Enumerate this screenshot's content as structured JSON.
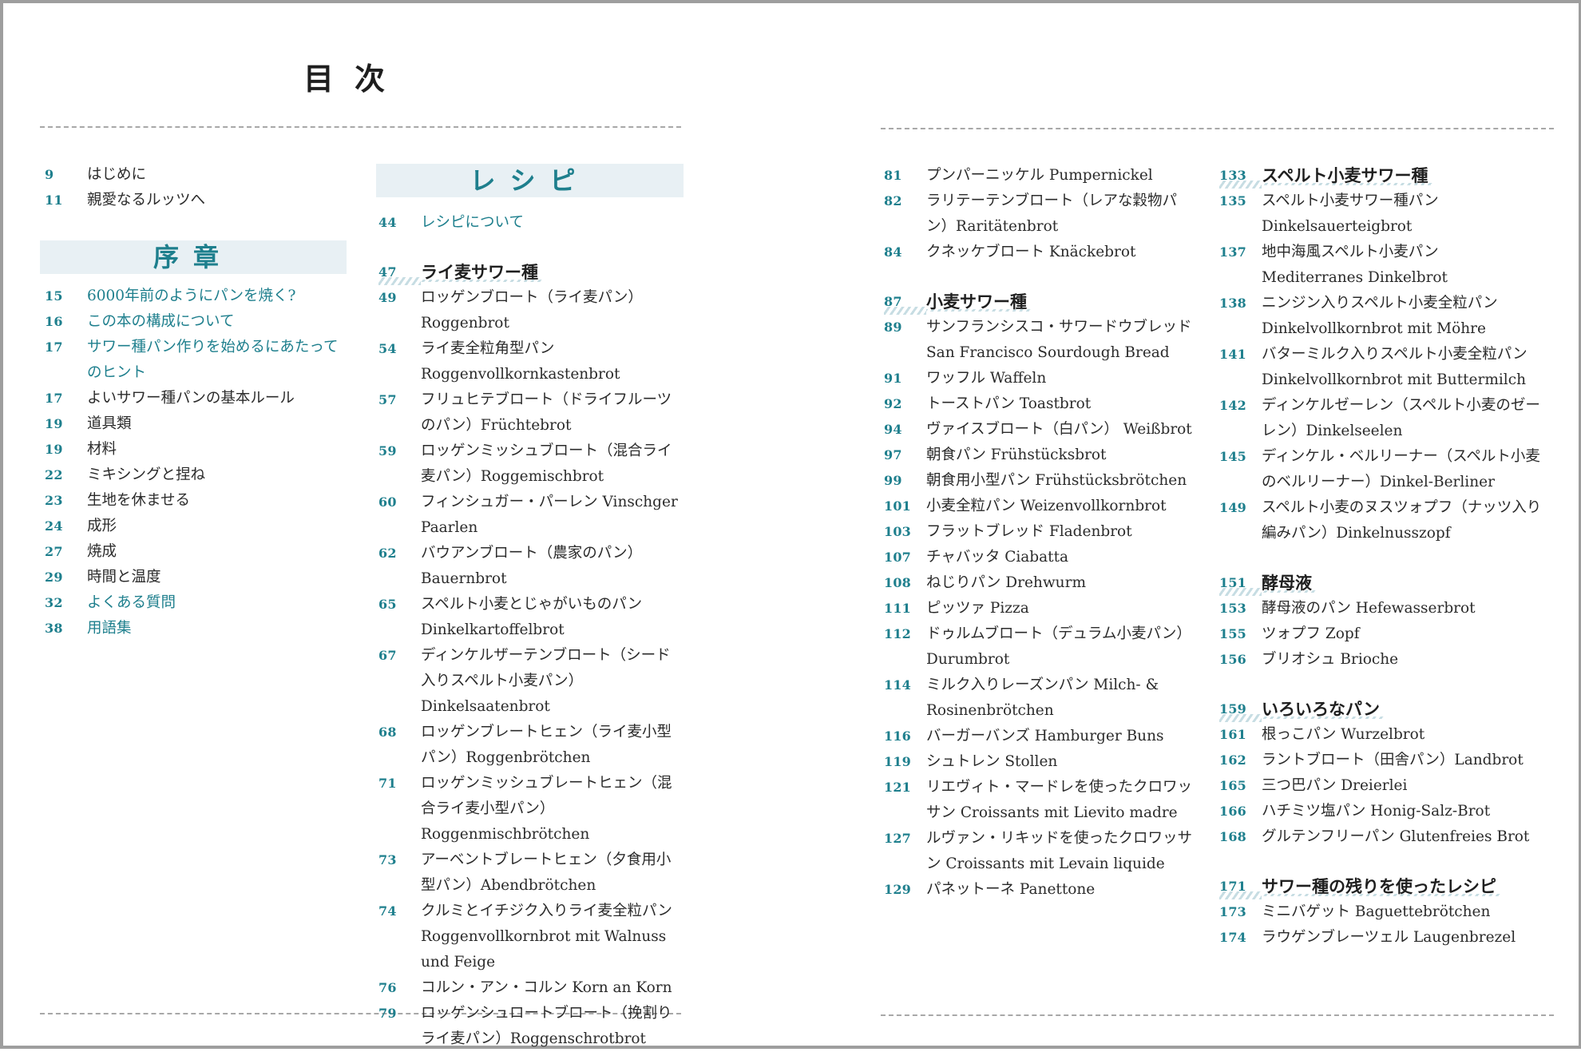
{
  "title": "目次",
  "colors": {
    "accent": "#1e7f8d",
    "banner_bg": "#e8f0f4",
    "text": "#2b2b2b"
  },
  "col1": {
    "intro": [
      {
        "page": "9",
        "text": "はじめに"
      },
      {
        "page": "11",
        "text": "親愛なるルッツへ"
      }
    ],
    "banner": "序章",
    "items": [
      {
        "page": "15",
        "text": "6000年前のようにパンを焼く?",
        "highlight": true
      },
      {
        "page": "16",
        "text": "この本の構成について",
        "highlight": true
      },
      {
        "page": "17",
        "text": "サワー種パン作りを始めるにあたってのヒント",
        "highlight": true
      },
      {
        "page": "17",
        "text": "よいサワー種パンの基本ルール"
      },
      {
        "page": "19",
        "text": "道具類"
      },
      {
        "page": "19",
        "text": "材料"
      },
      {
        "page": "22",
        "text": "ミキシングと捏ね"
      },
      {
        "page": "23",
        "text": "生地を休ませる"
      },
      {
        "page": "24",
        "text": "成形"
      },
      {
        "page": "27",
        "text": "焼成"
      },
      {
        "page": "29",
        "text": "時間と温度"
      },
      {
        "page": "32",
        "text": "よくある質問",
        "highlight": true
      },
      {
        "page": "38",
        "text": "用語集",
        "highlight": true
      }
    ]
  },
  "col2": {
    "banner": "レシピ",
    "items": [
      {
        "page": "44",
        "text": "レシピについて",
        "highlight": true
      },
      {
        "page": "47",
        "text": "ライ麦サワー種",
        "section": true
      },
      {
        "page": "49",
        "text": "ロッゲンブロート（ライ麦パン）Roggenbrot"
      },
      {
        "page": "54",
        "text": "ライ麦全粒角型パン Roggenvollkornkastenbrot"
      },
      {
        "page": "57",
        "text": "フリュヒテブロート（ドライフルーツのパン）Früchtebrot"
      },
      {
        "page": "59",
        "text": "ロッゲンミッシュブロート（混合ライ麦パン）Roggemischbrot"
      },
      {
        "page": "60",
        "text": "フィンシュガー・パーレン Vinschger Paarlen"
      },
      {
        "page": "62",
        "text": "バウアンブロート（農家のパン）Bauernbrot"
      },
      {
        "page": "65",
        "text": "スペルト小麦とじゃがいものパン Dinkelkartoffelbrot"
      },
      {
        "page": "67",
        "text": "ディンケルザーテンブロート（シード入りスペルト小麦パン）Dinkelsaatenbrot"
      },
      {
        "page": "68",
        "text": "ロッゲンブレートヒェン（ライ麦小型パン）Roggenbrötchen"
      },
      {
        "page": "71",
        "text": "ロッゲンミッシュブレートヒェン（混合ライ麦小型パン）Roggenmischbrötchen"
      },
      {
        "page": "73",
        "text": "アーベントブレートヒェン（夕食用小型パン）Abendbrötchen"
      },
      {
        "page": "74",
        "text": "クルミとイチジク入りライ麦全粒パン Roggenvollkornbrot mit Walnuss und Feige"
      },
      {
        "page": "76",
        "text": "コルン・アン・コルン Korn an Korn"
      },
      {
        "page": "79",
        "text": "ロッゲンシュロートブロート（挽割りライ麦パン）Roggenschrotbrot"
      }
    ]
  },
  "col3": {
    "items": [
      {
        "page": "81",
        "text": "プンパーニッケル Pumpernickel"
      },
      {
        "page": "82",
        "text": "ラリテーテンブロート（レアな穀物パン）Raritätenbrot"
      },
      {
        "page": "84",
        "text": "クネッケブロート Knäckebrot"
      },
      {
        "page": "87",
        "text": "小麦サワー種",
        "section": true
      },
      {
        "page": "89",
        "text": "サンフランシスコ・サワードウブレッド San Francisco Sourdough Bread"
      },
      {
        "page": "91",
        "text": "ワッフル Waffeln"
      },
      {
        "page": "92",
        "text": "トーストパン Toastbrot"
      },
      {
        "page": "94",
        "text": "ヴァイスブロート（白パン） Weißbrot"
      },
      {
        "page": "97",
        "text": "朝食パン Frühstücksbrot"
      },
      {
        "page": "99",
        "text": "朝食用小型パン Frühstücksbrötchen"
      },
      {
        "page": "101",
        "text": "小麦全粒パン Weizenvollkornbrot"
      },
      {
        "page": "103",
        "text": "フラットブレッド Fladenbrot"
      },
      {
        "page": "107",
        "text": "チャバッタ Ciabatta"
      },
      {
        "page": "108",
        "text": "ねじりパン Drehwurm"
      },
      {
        "page": "111",
        "text": "ピッツァ Pizza"
      },
      {
        "page": "112",
        "text": "ドゥルムブロート（デュラム小麦パン）Durumbrot"
      },
      {
        "page": "114",
        "text": "ミルク入りレーズンパン Milch- & Rosinenbrötchen"
      },
      {
        "page": "116",
        "text": "バーガーバンズ Hamburger Buns"
      },
      {
        "page": "119",
        "text": "シュトレン Stollen"
      },
      {
        "page": "121",
        "text": "リエヴィト・マードレを使ったクロワッサン Croissants mit Lievito madre"
      },
      {
        "page": "127",
        "text": "ルヴァン・リキッドを使ったクロワッサン Croissants mit Levain liquide"
      },
      {
        "page": "129",
        "text": "パネットーネ Panettone"
      }
    ]
  },
  "col4": {
    "items": [
      {
        "page": "133",
        "text": "スペルト小麦サワー種",
        "section": true,
        "first": true
      },
      {
        "page": "135",
        "text": "スペルト小麦サワー種パン Dinkelsauerteigbrot"
      },
      {
        "page": "137",
        "text": "地中海風スペルト小麦パン Mediterranes Dinkelbrot"
      },
      {
        "page": "138",
        "text": "ニンジン入りスペルト小麦全粒パン Dinkelvollkornbrot mit Möhre"
      },
      {
        "page": "141",
        "text": "バターミルク入りスペルト小麦全粒パン Dinkelvollkornbrot mit Buttermilch"
      },
      {
        "page": "142",
        "text": "ディンケルゼーレン（スペルト小麦のゼーレン）Dinkelseelen"
      },
      {
        "page": "145",
        "text": "ディンケル・ベルリーナー（スペルト小麦のベルリーナー）Dinkel-Berliner"
      },
      {
        "page": "149",
        "text": "スペルト小麦のヌスツォプフ（ナッツ入り編みパン）Dinkelnusszopf"
      },
      {
        "page": "151",
        "text": "酵母液",
        "section": true
      },
      {
        "page": "153",
        "text": "酵母液のパン Hefewasserbrot"
      },
      {
        "page": "155",
        "text": "ツォプフ Zopf"
      },
      {
        "page": "156",
        "text": "ブリオシュ Brioche"
      },
      {
        "page": "159",
        "text": "いろいろなパン",
        "section": true
      },
      {
        "page": "161",
        "text": "根っこパン Wurzelbrot"
      },
      {
        "page": "162",
        "text": "ラントブロート（田舎パン）Landbrot"
      },
      {
        "page": "165",
        "text": "三つ巴パン Dreierlei"
      },
      {
        "page": "166",
        "text": "ハチミツ塩パン Honig-Salz-Brot"
      },
      {
        "page": "168",
        "text": "グルテンフリーパン Glutenfreies Brot"
      },
      {
        "page": "171",
        "text": "サワー種の残りを使ったレシピ",
        "section": true
      },
      {
        "page": "173",
        "text": "ミニバゲット Baguettebrötchen"
      },
      {
        "page": "174",
        "text": "ラウゲンブレーツェル Laugenbrezel"
      }
    ]
  }
}
